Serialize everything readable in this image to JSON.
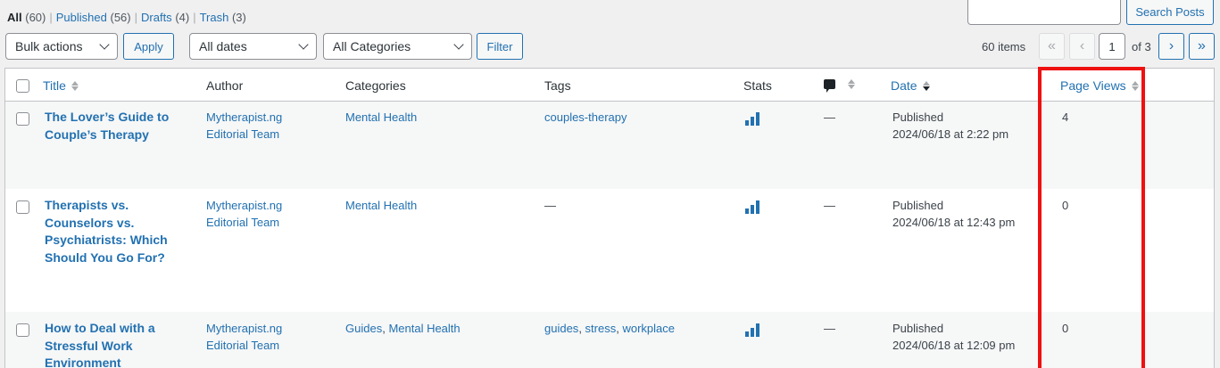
{
  "views": [
    {
      "label": "All",
      "count": "(60)",
      "current": true
    },
    {
      "label": "Published",
      "count": "(56)",
      "current": false
    },
    {
      "label": "Drafts",
      "count": "(4)",
      "current": false
    },
    {
      "label": "Trash",
      "count": "(3)",
      "current": false
    }
  ],
  "search": {
    "placeholder": "",
    "button": "Search Posts"
  },
  "filters": {
    "bulk_actions": "Bulk actions",
    "apply": "Apply",
    "dates": "All dates",
    "categories": "All Categories",
    "filter": "Filter"
  },
  "pagination": {
    "items": "60 items",
    "first": "«",
    "prev": "‹",
    "current_page": "1",
    "of_text": "of 3",
    "next": "›",
    "last": "»"
  },
  "columns": {
    "title": "Title",
    "author": "Author",
    "categories": "Categories",
    "tags": "Tags",
    "stats": "Stats",
    "date": "Date",
    "page_views": "Page Views"
  },
  "rows": [
    {
      "title_lines": [
        "The Lover’s Guide to",
        "Couple’s Therapy"
      ],
      "author_lines": [
        "Mytherapist.ng",
        "Editorial Team"
      ],
      "categories": "Mental Health",
      "tags": "couples-therapy",
      "comments": "—",
      "status": "Published",
      "date": "2024/06/18 at 2:22 pm",
      "page_views": "4"
    },
    {
      "title_lines": [
        "Therapists vs.",
        "Counselors vs.",
        "Psychiatrists: Which",
        "Should You Go For?"
      ],
      "author_lines": [
        "Mytherapist.ng",
        "Editorial Team"
      ],
      "categories": "Mental Health",
      "tags": "—",
      "comments": "—",
      "status": "Published",
      "date": "2024/06/18 at 12:43 pm",
      "page_views": "0"
    },
    {
      "title_lines": [
        "How to Deal with a",
        "Stressful Work",
        "Environment"
      ],
      "author_lines": [
        "Mytherapist.ng",
        "Editorial Team"
      ],
      "categories_list": [
        "Guides",
        "Mental Health"
      ],
      "tags_list": [
        "guides",
        "stress",
        "workplace"
      ],
      "comments": "—",
      "status": "Published",
      "date": "2024/06/18 at 12:09 pm",
      "page_views": "0"
    }
  ],
  "colors": {
    "accent": "#2271b1",
    "highlight": "#ee1111"
  },
  "icons": [
    "sort-icon",
    "comment-bubble-icon",
    "stats-bars-icon",
    "chevron-down-icon"
  ]
}
